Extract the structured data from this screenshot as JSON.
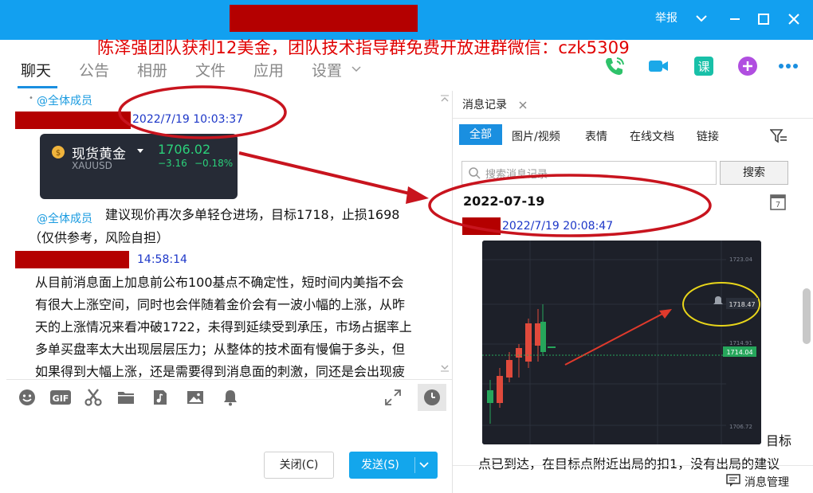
{
  "titlebar": {
    "report": "举报",
    "bg": "#12a0f0"
  },
  "banner": "陈泽强团队获利12美金，团队技术指导群免费开放进群微信：czk5309",
  "tabs": [
    "聊天",
    "公告",
    "相册",
    "文件",
    "应用",
    "设置"
  ],
  "left": {
    "at_all_1": "@全体成员",
    "ts1": "2022/7/19 10:03:37",
    "gold": {
      "name": "现货黄金",
      "symbol": "XAUUSD",
      "price": "1706.02",
      "change": "−3.16",
      "pct": "−0.18%"
    },
    "at_all_2": "@全体成员",
    "msg2_a": "建议现价再次多单轻仓进场，目标1718，止损1698",
    "msg2_b": "（仅供参考，风险自担）",
    "ts2": "14:58:14",
    "msg3_lines": [
      "从目前消息面上加息前公布100基点不确定性，短时间内美指不会",
      "有很大上涨空间，同时也会伴随着金价会有一波小幅的上涨，从昨",
      "天的上涨情况来看冲破1722，未得到延续受到承压，市场占据率上",
      "多单买盘率太大出现层层压力；从整体的技术面有慢偏于多头，但",
      "如果得到大幅上涨，还是需要得到消息面的刺激，同还是会出现疲"
    ]
  },
  "buttons": {
    "close": "关闭(C)",
    "send": "发送(S)"
  },
  "right": {
    "tab_title": "消息记录",
    "filters": [
      "全部",
      "图片/视频",
      "表情",
      "在线文档",
      "链接"
    ],
    "search_placeholder": "搜索消息记录",
    "search_btn": "搜索",
    "date": "2022-07-19",
    "ts": "2022/7/19 20:08:47",
    "chart_labels": {
      "p1": "1723.04",
      "p2": "1718.47",
      "p3": "1714.91",
      "p4": "1714.04",
      "p5": "1706.72"
    },
    "after_text_1": "目标",
    "after_text_2": "点已到达，在目标点附近出局的扣1，没有出局的建议",
    "manage": "消息管理"
  },
  "colors": {
    "accent": "#1a8fe0",
    "redact": "#b40000",
    "timestamp": "#1d37c8",
    "at_mention": "#1a9be0",
    "annotation": "#c8141e"
  }
}
